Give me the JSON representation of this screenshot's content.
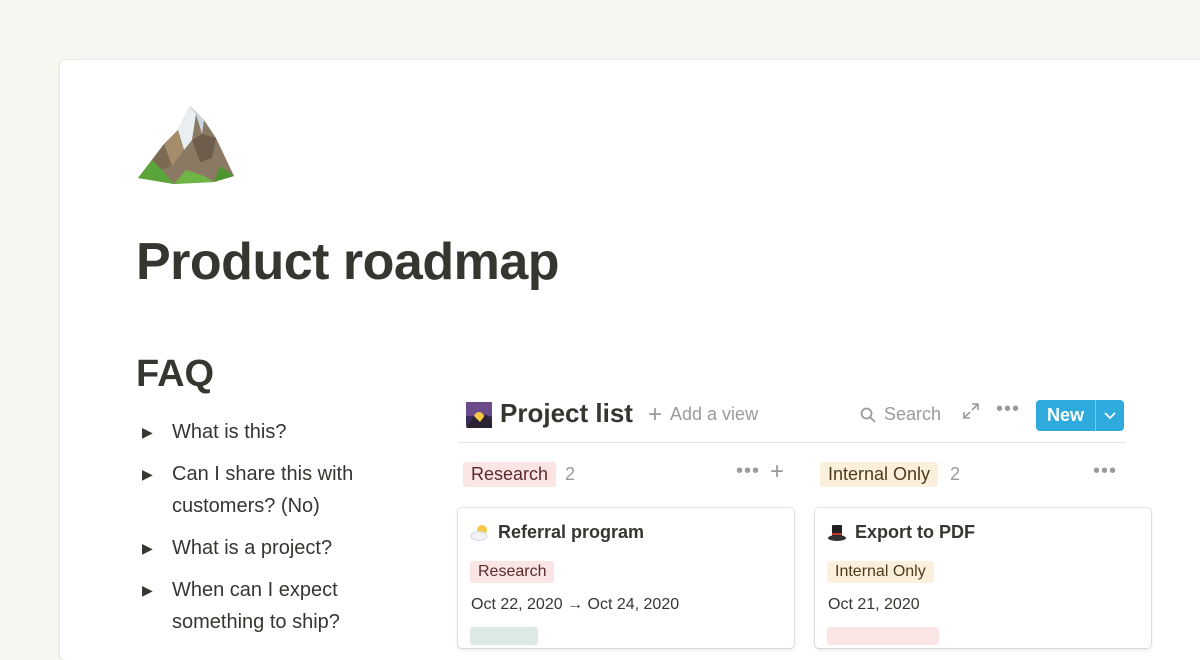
{
  "page": {
    "icon": "mountain-icon",
    "title": "Product roadmap"
  },
  "faq": {
    "heading": "FAQ",
    "items": [
      {
        "text": "What is this?"
      },
      {
        "text": "Can I share this with customers? (No)"
      },
      {
        "text": "What is a project?"
      },
      {
        "text": "When can I expect something to ship?"
      }
    ]
  },
  "database": {
    "icon": "sunrise-image-icon",
    "title": "Project list",
    "add_view_label": "Add a view",
    "search_label": "Search",
    "new_label": "New",
    "columns": [
      {
        "tag": "Research",
        "count": "2",
        "card": {
          "icon": "sun-behind-cloud-icon",
          "title": "Referral program",
          "tag": "Research",
          "date": "Oct 22, 2020 → Oct 24, 2020"
        }
      },
      {
        "tag": "Internal Only",
        "count": "2",
        "card": {
          "icon": "top-hat-icon",
          "title": "Export to PDF",
          "tag": "Internal Only",
          "date": "Oct 21, 2020"
        }
      }
    ]
  },
  "colors": {
    "accent_blue": "#2eaadc",
    "research_tag_bg": "#fbe4e4",
    "internal_tag_bg": "#fbf0dc",
    "page_bg": "#f7f5f0"
  }
}
